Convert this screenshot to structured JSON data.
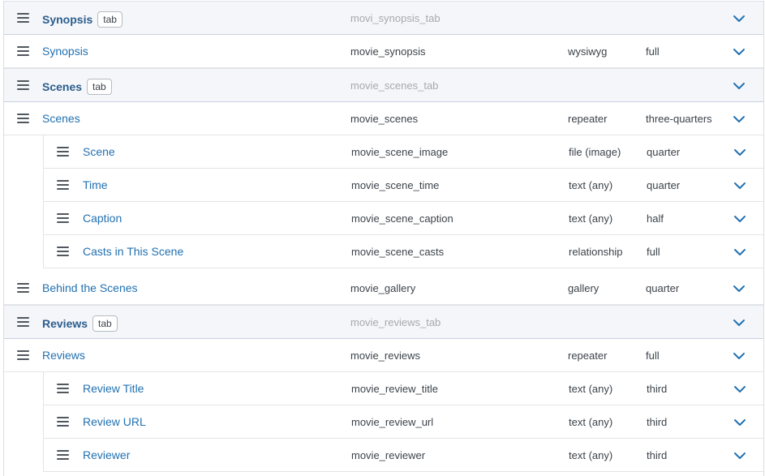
{
  "fields": [
    {
      "kind": "tab",
      "label": "Synopsis",
      "badge": "tab",
      "name": "movi_synopsis_tab",
      "type": "",
      "width": ""
    },
    {
      "kind": "field",
      "label": "Synopsis",
      "name": "movie_synopsis",
      "type": "wysiwyg",
      "width": "full"
    },
    {
      "kind": "tab",
      "label": "Scenes",
      "badge": "tab",
      "name": "movie_scenes_tab",
      "type": "",
      "width": ""
    },
    {
      "kind": "field",
      "label": "Scenes",
      "name": "movie_scenes",
      "type": "repeater",
      "width": "three-quarters",
      "sub_fields": [
        {
          "label": "Scene",
          "name": "movie_scene_image",
          "type": "file (image)",
          "width": "quarter"
        },
        {
          "label": "Time",
          "name": "movie_scene_time",
          "type": "text (any)",
          "width": "quarter"
        },
        {
          "label": "Caption",
          "name": "movie_scene_caption",
          "type": "text (any)",
          "width": "half"
        },
        {
          "label": "Casts in This Scene",
          "name": "movie_scene_casts",
          "type": "relationship",
          "width": "full"
        }
      ]
    },
    {
      "kind": "field",
      "label": "Behind the Scenes",
      "name": "movie_gallery",
      "type": "gallery",
      "width": "quarter"
    },
    {
      "kind": "tab",
      "label": "Reviews",
      "badge": "tab",
      "name": "movie_reviews_tab",
      "type": "",
      "width": ""
    },
    {
      "kind": "field",
      "label": "Reviews",
      "name": "movie_reviews",
      "type": "repeater",
      "width": "full",
      "sub_fields": [
        {
          "label": "Review Title",
          "name": "movie_review_title",
          "type": "text (any)",
          "width": "third"
        },
        {
          "label": "Review URL",
          "name": "movie_review_url",
          "type": "text (any)",
          "width": "third"
        },
        {
          "label": "Reviewer",
          "name": "movie_reviewer",
          "type": "text (any)",
          "width": "third"
        }
      ]
    }
  ],
  "icons": {
    "handle": "drag-handle-icon",
    "toggle": "chevron-down-icon"
  },
  "colors": {
    "label": "#2271b1",
    "tab_row_bg": "#f4f6fa",
    "chevron": "#2271b1"
  }
}
